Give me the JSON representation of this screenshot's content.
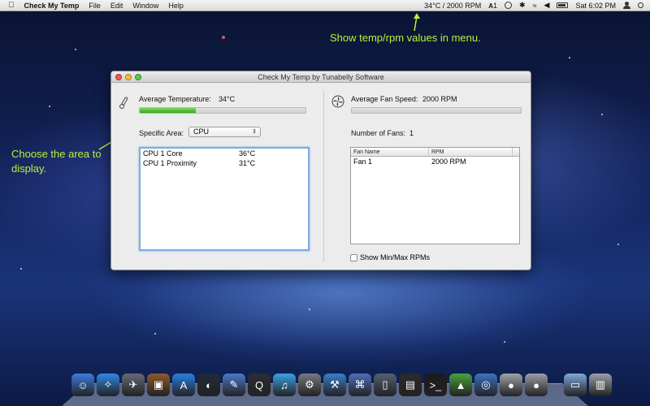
{
  "menubar": {
    "apple_icon": "apple-icon",
    "app_name": "Check My Temp",
    "menus": [
      "File",
      "Edit",
      "Window",
      "Help"
    ],
    "status_temp_rpm": "34°C / 2000 RPM",
    "status_extra": "1",
    "clock": "Sat 6:02 PM"
  },
  "annotations": {
    "menu_note": "Show temp/rpm values in menu.",
    "area_note": "Choose the area to display."
  },
  "window": {
    "title": "Check My Temp by Tunabelly Software",
    "left": {
      "avg_temp_label": "Average Temperature:",
      "avg_temp_value": "34°C",
      "temp_bar_fraction": 0.34,
      "specific_area_label": "Specific Area:",
      "specific_area_value": "CPU",
      "sensors": [
        {
          "name": "CPU 1 Core",
          "value": "36°C"
        },
        {
          "name": "CPU 1 Proximity",
          "value": "31°C"
        }
      ]
    },
    "right": {
      "avg_fan_label": "Average Fan Speed:",
      "avg_fan_value": "2000 RPM",
      "fan_bar_fraction": 0.0,
      "num_fans_label": "Number of Fans:",
      "num_fans_value": "1",
      "table_headers": [
        "Fan Name",
        "RPM"
      ],
      "fans": [
        {
          "name": "Fan 1",
          "rpm": "2000 RPM"
        }
      ],
      "show_minmax_label": "Show Min/Max RPMs"
    }
  },
  "dock": {
    "icons": [
      {
        "name": "finder-icon",
        "color": "#3d7be0"
      },
      {
        "name": "safari-icon",
        "color": "#2f88e5"
      },
      {
        "name": "launchpad-icon",
        "color": "#666a78"
      },
      {
        "name": "photo-icon",
        "color": "#8c5a2b"
      },
      {
        "name": "app-store-icon",
        "color": "#2a7fe0"
      },
      {
        "name": "dashboard-icon",
        "color": "#222a38"
      },
      {
        "name": "preview-icon",
        "color": "#4b79c9"
      },
      {
        "name": "quicktime-icon",
        "color": "#2a2e36"
      },
      {
        "name": "itunes-icon",
        "color": "#3aa3e6"
      },
      {
        "name": "system-preferences-icon",
        "color": "#777a80"
      },
      {
        "name": "xcode-icon",
        "color": "#3a7ec8"
      },
      {
        "name": "utility-icon",
        "color": "#4d6fb8"
      },
      {
        "name": "window-icon",
        "color": "#556070"
      },
      {
        "name": "console-icon",
        "color": "#2b2b2b"
      },
      {
        "name": "terminal-icon",
        "color": "#1b1b1b"
      },
      {
        "name": "activity-monitor-icon",
        "color": "#48a23f"
      },
      {
        "name": "network-icon",
        "color": "#3a73c4"
      },
      {
        "name": "disk-icon",
        "color": "#a0a4aa"
      },
      {
        "name": "disk-icon",
        "color": "#9a9ea5"
      },
      {
        "name": "folder-icon",
        "color": "#7fa9d6"
      },
      {
        "name": "trash-icon",
        "color": "#9aa0a8"
      }
    ]
  }
}
